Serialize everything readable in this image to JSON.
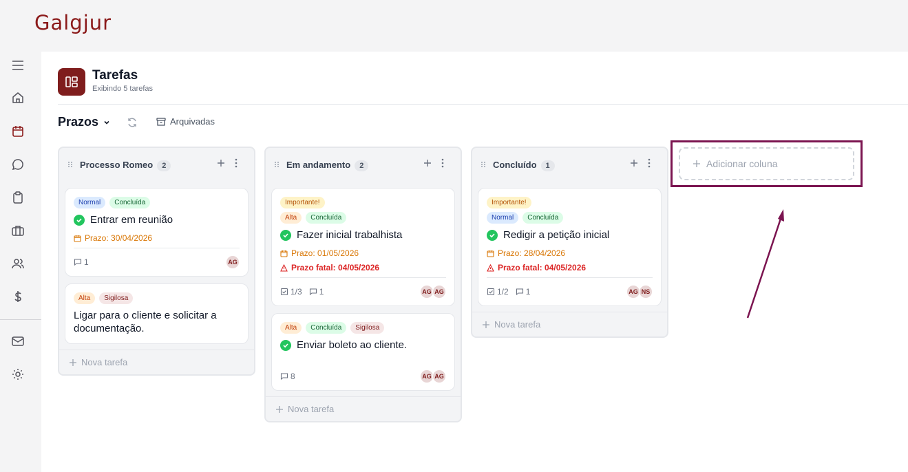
{
  "app": {
    "logo": "Galgjur",
    "brand_color": "#7f1d1d",
    "annotation_color": "#7b1450"
  },
  "sidebar": {
    "items": [
      {
        "name": "menu-icon"
      },
      {
        "name": "home-icon"
      },
      {
        "name": "calendar-icon"
      },
      {
        "name": "chat-icon"
      },
      {
        "name": "clipboard-icon"
      },
      {
        "name": "briefcase-icon"
      },
      {
        "name": "users-icon"
      },
      {
        "name": "dollar-icon"
      },
      {
        "name": "mail-icon"
      },
      {
        "name": "settings-icon"
      }
    ]
  },
  "header": {
    "title": "Tarefas",
    "subtitle": "Exibindo 5 tarefas"
  },
  "toolbar": {
    "board_name": "Prazos",
    "archived_label": "Arquivadas"
  },
  "columns": [
    {
      "title": "Processo Romeo",
      "count": "2",
      "new_task": "Nova tarefa",
      "cards": [
        {
          "tags": [
            "Normal",
            "Concluída"
          ],
          "title": "Entrar em reunião",
          "prazo": "Prazo: 30/04/2026",
          "comments": "1",
          "avatars": [
            "AG"
          ]
        },
        {
          "tags": [
            "Alta",
            "Sigilosa"
          ],
          "title": "Ligar para o cliente e solicitar a documentação."
        }
      ]
    },
    {
      "title": "Em andamento",
      "count": "2",
      "new_task": "Nova tarefa",
      "cards": [
        {
          "tags": [
            "Importante!"
          ],
          "tags2": [
            "Alta",
            "Concluída"
          ],
          "title": "Fazer inicial trabalhista",
          "prazo": "Prazo: 01/05/2026",
          "fatal": "Prazo fatal: 04/05/2026",
          "checklist": "1/3",
          "comments": "1",
          "avatars": [
            "AG",
            "AG"
          ]
        },
        {
          "tags": [
            "Alta",
            "Concluída",
            "Sigilosa"
          ],
          "title": "Enviar boleto ao cliente.",
          "comments": "8",
          "avatars": [
            "AG",
            "AG"
          ]
        }
      ]
    },
    {
      "title": "Concluído",
      "count": "1",
      "new_task": "Nova tarefa",
      "cards": [
        {
          "tags": [
            "Importante!"
          ],
          "tags2": [
            "Normal",
            "Concluída"
          ],
          "title": "Redigir a petição inicial",
          "prazo": "Prazo: 28/04/2026",
          "fatal": "Prazo fatal: 04/05/2026",
          "checklist": "1/2",
          "comments": "1",
          "avatars": [
            "AG",
            "NS"
          ]
        }
      ]
    }
  ],
  "add_column": {
    "label": "Adicionar coluna"
  }
}
